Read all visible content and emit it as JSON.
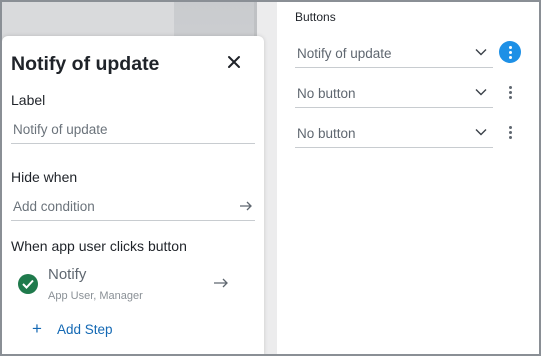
{
  "panel": {
    "title": "Notify of update",
    "label_heading": "Label",
    "label_value": "Notify of update",
    "hide_when_heading": "Hide when",
    "hide_when_placeholder": "Add condition",
    "clicks_heading": "When app user clicks button",
    "step": {
      "title": "Notify",
      "subtitle": "App User, Manager"
    },
    "add_step_label": "Add Step"
  },
  "buttons_section": {
    "title": "Buttons",
    "rows": [
      {
        "value": "Notify of update",
        "menu_active": true
      },
      {
        "value": "No button",
        "menu_active": false
      },
      {
        "value": "No button",
        "menu_active": false
      }
    ]
  },
  "colors": {
    "accent": "#1e90e6",
    "link": "#1469b4",
    "success": "#1f7a4c"
  },
  "icons": [
    "close-icon",
    "arrow-right-icon",
    "chevron-down-icon",
    "more-vertical-icon",
    "check-circle-icon",
    "plus-icon"
  ]
}
